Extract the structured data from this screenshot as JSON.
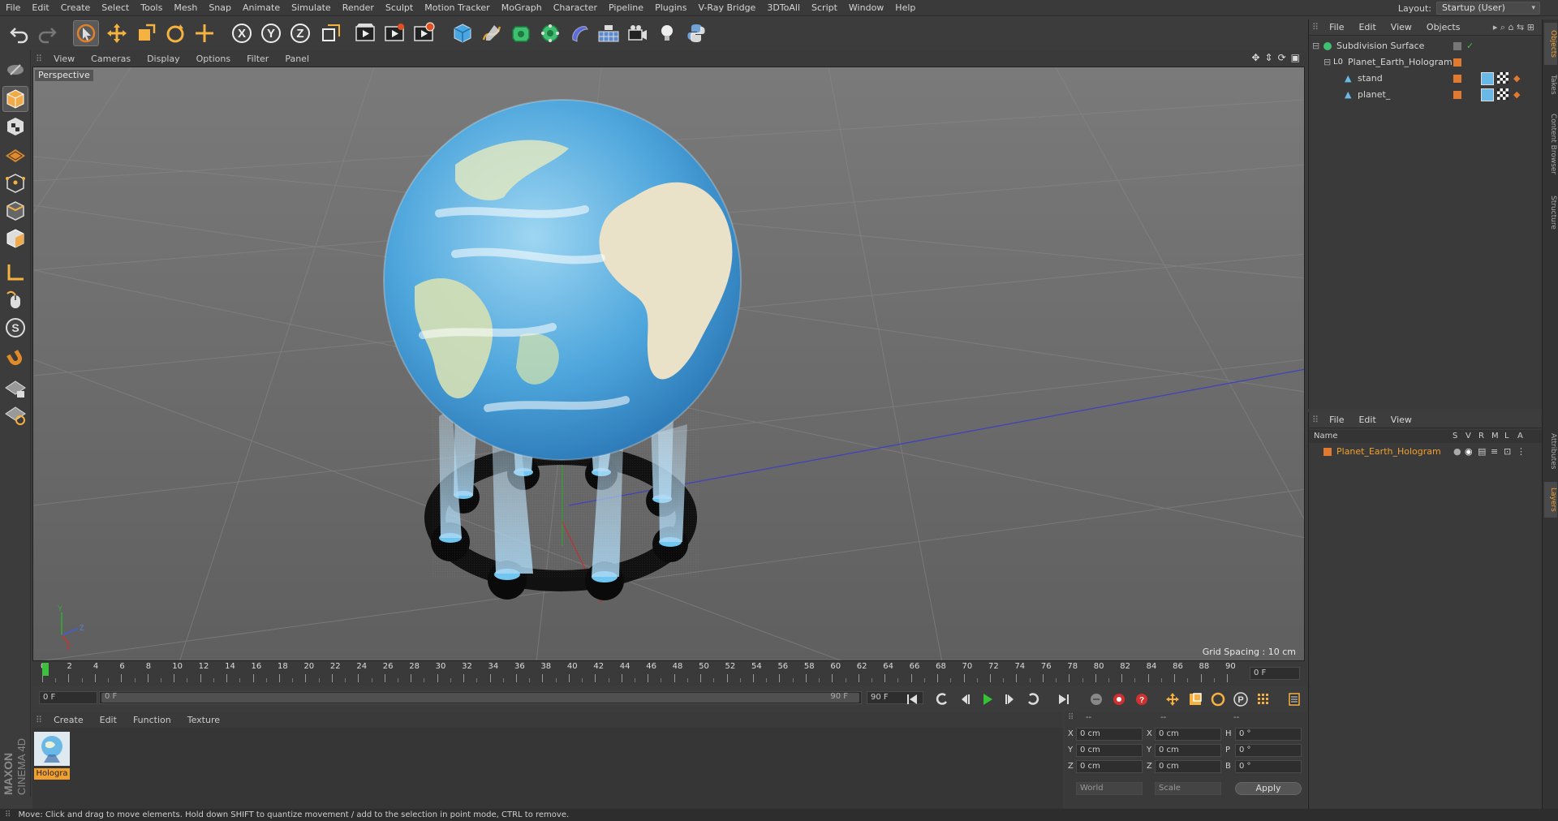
{
  "menubar": {
    "items": [
      "File",
      "Edit",
      "Create",
      "Select",
      "Tools",
      "Mesh",
      "Snap",
      "Animate",
      "Simulate",
      "Render",
      "Sculpt",
      "Motion Tracker",
      "MoGraph",
      "Character",
      "Pipeline",
      "Plugins",
      "V-Ray Bridge",
      "3DToAll",
      "Script",
      "Window",
      "Help"
    ],
    "layout_label": "Layout:",
    "layout_value": "Startup (User)"
  },
  "toolbar": {
    "icons": [
      "undo-icon",
      "redo-icon",
      "select-arrow-icon",
      "move-icon",
      "scale-icon",
      "rotate-icon",
      "live-select-icon",
      "x-axis-icon",
      "y-axis-icon",
      "z-axis-icon",
      "coordinate-system-icon",
      "render-view-icon",
      "render-picture-viewer-icon",
      "edit-render-settings-icon",
      "cube-primitive-icon",
      "pen-spline-icon",
      "subdivision-nurbs-icon",
      "cloner-icon",
      "deformer-icon",
      "floor-icon",
      "camera-icon",
      "light-icon",
      "python-icon"
    ]
  },
  "viewport": {
    "menu": [
      "View",
      "Cameras",
      "Display",
      "Options",
      "Filter",
      "Panel"
    ],
    "label": "Perspective",
    "grid_spacing": "Grid Spacing : 10 cm"
  },
  "timeline": {
    "ticks": [
      "0",
      "2",
      "4",
      "6",
      "8",
      "10",
      "12",
      "14",
      "16",
      "18",
      "20",
      "22",
      "24",
      "26",
      "28",
      "30",
      "32",
      "34",
      "36",
      "38",
      "40",
      "42",
      "44",
      "46",
      "48",
      "50",
      "52",
      "54",
      "56",
      "58",
      "60",
      "62",
      "64",
      "66",
      "68",
      "70",
      "72",
      "74",
      "76",
      "78",
      "80",
      "82",
      "84",
      "86",
      "88",
      "90"
    ],
    "current_frame": "0 F",
    "start_field": "0 F",
    "slider_start": "0 F",
    "slider_end": "90 F",
    "end_field": "90 F"
  },
  "material_manager": {
    "menu": [
      "Create",
      "Edit",
      "Function",
      "Texture"
    ],
    "material_name": "Hologra"
  },
  "coordinates": {
    "headers": [
      "--",
      "--",
      "--"
    ],
    "rows": [
      {
        "a_label": "X",
        "a_val": "0 cm",
        "b_label": "X",
        "b_val": "0 cm",
        "c_label": "H",
        "c_val": "0 °"
      },
      {
        "a_label": "Y",
        "a_val": "0 cm",
        "b_label": "Y",
        "b_val": "0 cm",
        "c_label": "P",
        "c_val": "0 °"
      },
      {
        "a_label": "Z",
        "a_val": "0 cm",
        "b_label": "Z",
        "b_val": "0 cm",
        "c_label": "B",
        "c_val": "0 °"
      }
    ],
    "mode_world": "World",
    "mode_scale": "Scale",
    "apply": "Apply"
  },
  "object_manager": {
    "menu": [
      "File",
      "Edit",
      "View",
      "Objects"
    ],
    "objects": [
      {
        "name": "Subdivision Surface",
        "indent": 0
      },
      {
        "name": "Planet_Earth_Hologram",
        "indent": 1
      },
      {
        "name": "stand",
        "indent": 2
      },
      {
        "name": "planet_",
        "indent": 2
      }
    ]
  },
  "layer_manager": {
    "menu": [
      "File",
      "Edit",
      "View"
    ],
    "columns": [
      "Name",
      "S",
      "V",
      "R",
      "M",
      "L",
      "A"
    ],
    "layers": [
      {
        "name": "Planet_Earth_Hologram",
        "color": "#e07a30"
      }
    ]
  },
  "right_tabs": [
    "Objects",
    "Takes",
    "Content Browser",
    "Structure",
    "Attributes",
    "Layers"
  ],
  "branding": {
    "line1": "MAXON",
    "line2": "CINEMA 4D"
  },
  "status": "Move: Click and drag to move elements. Hold down SHIFT to quantize movement / add to the selection in point mode, CTRL to remove.",
  "colors": {
    "accent_orange": "#f0a030",
    "viewport_bg": "#6e6e6e",
    "layer_orange": "#e07a30"
  }
}
